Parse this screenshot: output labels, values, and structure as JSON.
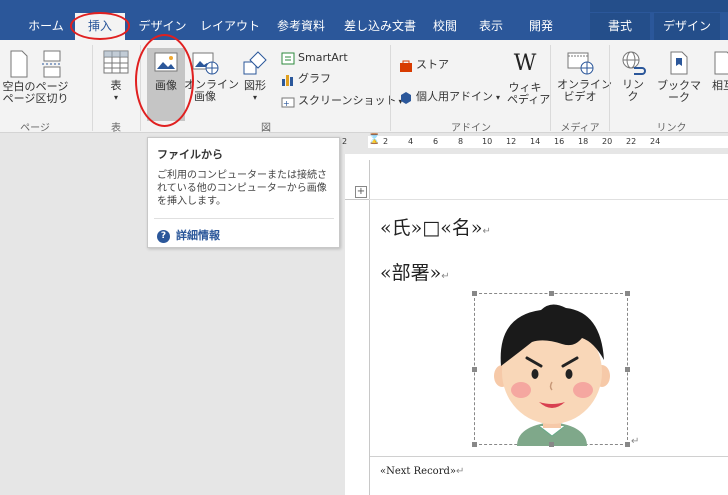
{
  "tabs": [
    {
      "label": "ホーム"
    },
    {
      "label": "挿入"
    },
    {
      "label": "デザイン"
    },
    {
      "label": "レイアウト"
    },
    {
      "label": "参考資料"
    },
    {
      "label": "差し込み文書"
    },
    {
      "label": "校閲"
    },
    {
      "label": "表示"
    },
    {
      "label": "開発"
    },
    {
      "label": "書式"
    },
    {
      "label": "デザイン"
    }
  ],
  "ribbon": {
    "pages": {
      "blank_page": "空白の\nページ",
      "page_break": "ページ\n区切り",
      "group": "ページ"
    },
    "table": {
      "label": "表",
      "group": "表"
    },
    "illustrations": {
      "pictures": "画像",
      "online_pictures": "オンライン\n画像",
      "shapes": "図形",
      "smartart": "SmartArt",
      "chart": "グラフ",
      "screenshot": "スクリーンショット",
      "group": "図"
    },
    "addins": {
      "store": "ストア",
      "my_addins": "個人用アドイン",
      "wikipedia": "ウィキ\nペディア",
      "group": "アドイン"
    },
    "media": {
      "online_video": "オンライン\nビデオ",
      "group": "メディア"
    },
    "links": {
      "link": "リン\nク",
      "bookmark": "ブックマーク",
      "crossref": "相互",
      "group": "リンク"
    }
  },
  "ruler": {
    "ticks": [
      "2",
      "2",
      "4",
      "6",
      "8",
      "10",
      "12",
      "14",
      "16",
      "18",
      "20",
      "22",
      "24"
    ]
  },
  "tooltip": {
    "title": "ファイルから",
    "description": "ご利用のコンピューターまたは接続されている他のコンピューターから画像を挿入します。",
    "help": "詳細情報"
  },
  "document": {
    "line1": "«氏»□«名»",
    "line2": "«部署»",
    "next_record": "«Next Record»",
    "para_mark": "↵"
  },
  "colors": {
    "accent": "#2b579a",
    "highlight": "#e02020"
  }
}
